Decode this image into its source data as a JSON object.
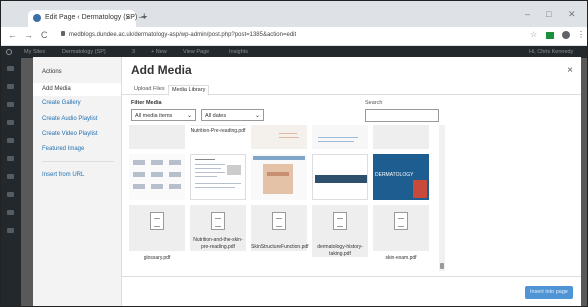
{
  "browser": {
    "tab_title": "Edit Page ‹ Dermatology (SP) —",
    "tab_close": "×",
    "new_tab": "+",
    "url": "medblogs.dundee.ac.uk/dermatology-asp/wp-admin/post.php?post=1385&action=edit",
    "back": "←",
    "forward": "→",
    "reload": "C",
    "star": "☆",
    "menu": "⋮"
  },
  "adminbar": {
    "my_sites": "My Sites",
    "site": "Dermatology (SP)",
    "comments": "3",
    "new": "+ New",
    "view": "View Page",
    "insights": "Insights",
    "howdy": "Hi, Chris Kennedy"
  },
  "modal": {
    "actions_heading": "Actions",
    "side_items": [
      "Add Media",
      "Create Gallery",
      "Create Audio Playlist",
      "Create Video Playlist",
      "Featured Image",
      "Insert from URL"
    ],
    "title": "Add Media",
    "close": "×",
    "tabs": [
      "Upload Files",
      "Media Library"
    ],
    "filter_label": "Filter Media",
    "filter_type": "All media items",
    "filter_date": "All dates",
    "search_label": "Search",
    "attachments_top": [
      "Nutrition-Pre-reading.pdf"
    ],
    "attachments_bottom": [
      "glossary.pdf",
      "Nutrition-and-the-skin-pre-reading.pdf",
      "SkinStructureFunction.pdf",
      "dermatology-history-taking.pdf",
      "skin-exam.pdf"
    ],
    "thumb_text_dermatology": "DERMATOLOGY",
    "insert_button": "Insert into page"
  },
  "colors": {
    "accent": "#2271b1",
    "admin_bar": "#23282d",
    "button": "#4f94d4"
  }
}
